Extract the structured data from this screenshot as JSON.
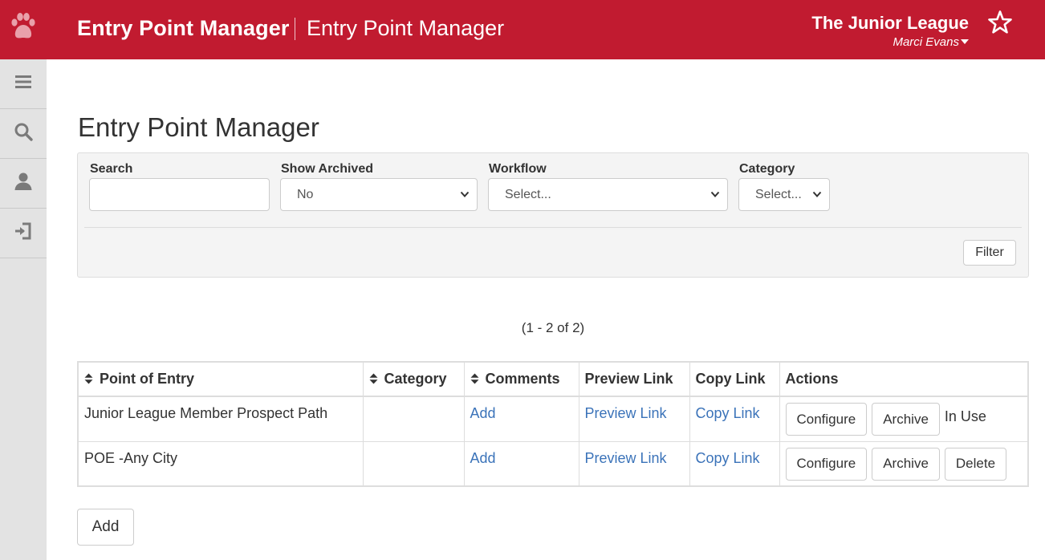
{
  "header": {
    "app_title": "Entry Point Manager",
    "page_title": "Entry Point Manager",
    "org_name": "The Junior League",
    "user_name": "Marci Evans",
    "brand_color": "#c11b30",
    "logo_icon": "paw-icon",
    "favorite_icon": "star-icon"
  },
  "sidebar": {
    "items": [
      {
        "icon": "menu-icon",
        "label": "Menu"
      },
      {
        "icon": "search-icon",
        "label": "Search"
      },
      {
        "icon": "user-icon",
        "label": "Profile"
      },
      {
        "icon": "sign-in-icon",
        "label": "Sign In"
      }
    ]
  },
  "main": {
    "heading": "Entry Point Manager"
  },
  "filters": {
    "search": {
      "label": "Search",
      "value": "",
      "placeholder": ""
    },
    "show_archived": {
      "label": "Show Archived",
      "value": "No"
    },
    "workflow": {
      "label": "Workflow",
      "value": "Select..."
    },
    "category": {
      "label": "Category",
      "value": "Select..."
    },
    "filter_button": "Filter"
  },
  "paging": {
    "text": "(1 - 2 of 2)"
  },
  "table": {
    "columns": [
      "Point of Entry",
      "Category",
      "Comments",
      "Preview Link",
      "Copy Link",
      "Actions"
    ],
    "rows": [
      {
        "point_of_entry": "Junior League Member Prospect Path",
        "category": "",
        "comments": "Add",
        "preview_link": "Preview Link",
        "copy_link": "Copy Link",
        "actions": [
          "Configure",
          "Archive"
        ],
        "status": "In Use"
      },
      {
        "point_of_entry": "POE -Any City",
        "category": "",
        "comments": "Add",
        "preview_link": "Preview Link",
        "copy_link": "Copy Link",
        "actions": [
          "Configure",
          "Archive",
          "Delete"
        ],
        "status": ""
      }
    ]
  },
  "footer": {
    "add_button": "Add"
  }
}
